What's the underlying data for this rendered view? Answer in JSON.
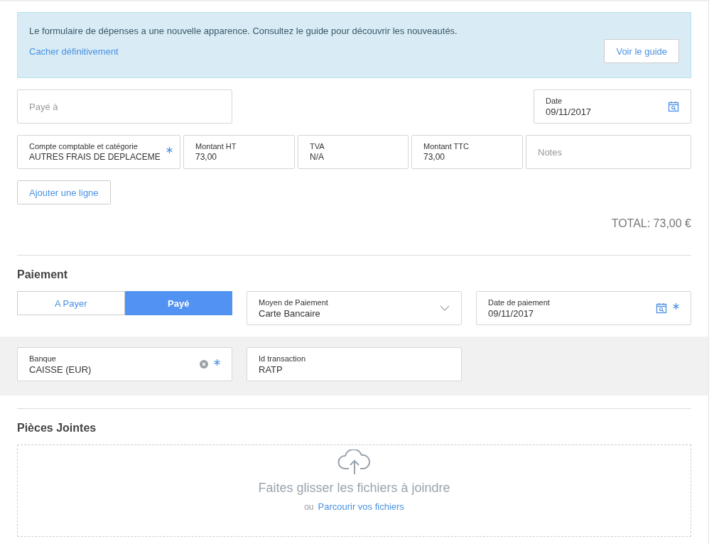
{
  "banner": {
    "text": "Le formulaire de dépenses a une nouvelle apparence. Consultez le guide pour découvrir les nouveautés.",
    "link": "Cacher définitivement",
    "button": "Voir le guide"
  },
  "payee": {
    "placeholder": "Payé à"
  },
  "date": {
    "label": "Date",
    "value": "09/11/2017"
  },
  "lines": [
    {
      "kind": "field",
      "label": "Compte comptable et catégorie",
      "value": "AUTRES FRAIS DE DEPLACEME",
      "required": true
    },
    {
      "kind": "field",
      "label": "Montant HT",
      "value": "73,00",
      "required": false
    },
    {
      "kind": "field",
      "label": "TVA",
      "value": "N/A",
      "required": false
    },
    {
      "kind": "field",
      "label": "Montant TTC",
      "value": "73,00",
      "required": false
    },
    {
      "kind": "placeholder",
      "placeholder": "Notes"
    }
  ],
  "add_line_button": "Ajouter une ligne",
  "total": "TOTAL: 73,00 €",
  "payment": {
    "title": "Paiement",
    "status": [
      {
        "label": "A Payer",
        "selected": false
      },
      {
        "label": "Payé",
        "selected": true
      }
    ],
    "method": {
      "label": "Moyen de Paiement",
      "value": "Carte Bancaire"
    },
    "payment_date": {
      "label": "Date de paiement",
      "value": "09/11/2017",
      "required": true
    },
    "bank": {
      "label": "Banque",
      "value": "CAISSE (EUR)",
      "required": true
    },
    "transaction": {
      "label": "Id transaction",
      "value": "RATP"
    }
  },
  "attachments": {
    "title": "Pièces Jointes",
    "drop_text": "Faites glisser les fichiers à joindre",
    "or_text": "ou",
    "browse_link": "Parcourir vos fichiers"
  }
}
